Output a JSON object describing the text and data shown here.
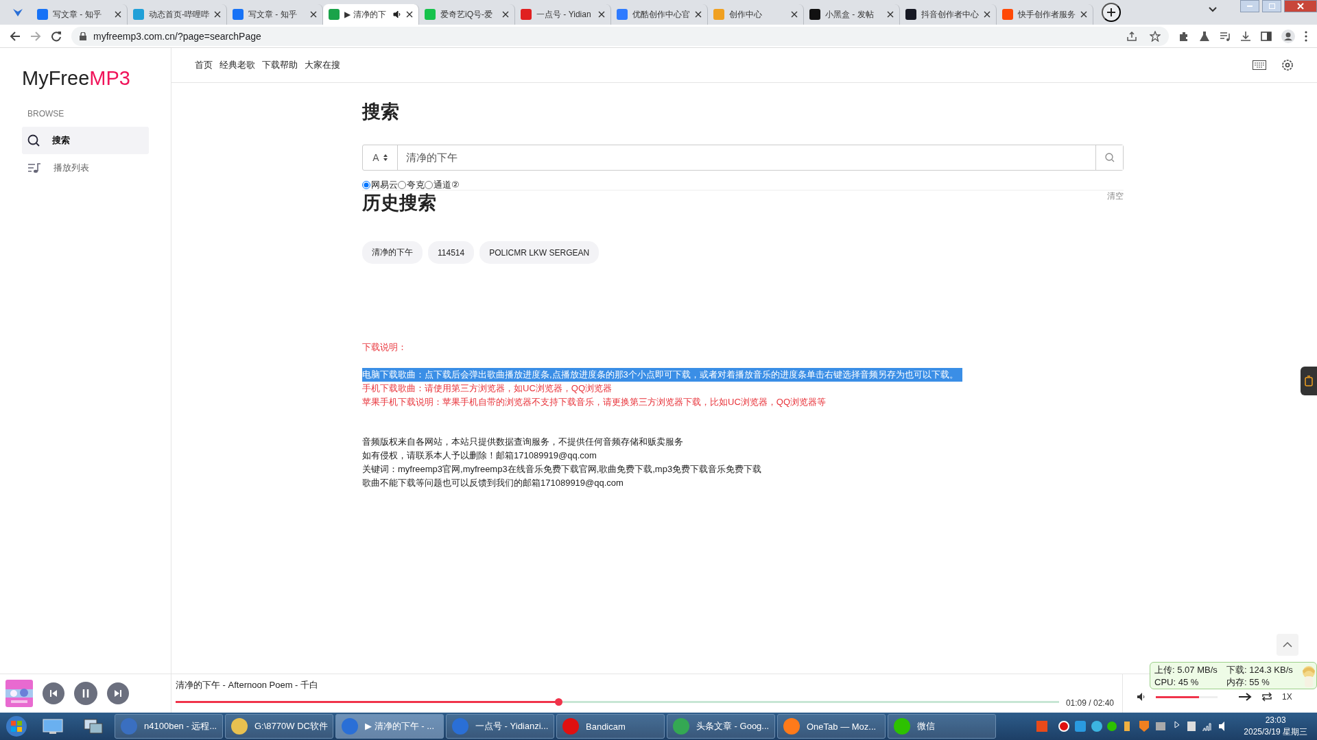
{
  "browser": {
    "tabs": [
      {
        "title": "写文章 - 知乎",
        "color": "#1772f6",
        "selected": false,
        "audio": false
      },
      {
        "title": "动态首页-哔哩哔",
        "color": "#20a0d8",
        "selected": false,
        "audio": false
      },
      {
        "title": "写文章 - 知乎",
        "color": "#1772f6",
        "selected": false,
        "audio": false
      },
      {
        "title": "▶ 清净的下",
        "color": "#1aa34a",
        "selected": true,
        "audio": true
      },
      {
        "title": "爱奇艺iQ号-爱",
        "color": "#16c24c",
        "selected": false,
        "audio": false
      },
      {
        "title": "一点号 - Yidian",
        "color": "#e02020",
        "selected": false,
        "audio": false
      },
      {
        "title": "优酷创作中心官",
        "color": "#2f7bff",
        "selected": false,
        "audio": false
      },
      {
        "title": "创作中心",
        "color": "#f0a020",
        "selected": false,
        "audio": false
      },
      {
        "title": "小黑盒 - 发帖",
        "color": "#111111",
        "selected": false,
        "audio": false
      },
      {
        "title": "抖音创作者中心",
        "color": "#161823",
        "selected": false,
        "audio": false
      },
      {
        "title": "快手创作者服务",
        "color": "#ff4906",
        "selected": false,
        "audio": false
      }
    ],
    "url": "myfreemp3.com.cn/?page=searchPage"
  },
  "logo": {
    "main": "MyFree",
    "accent": "MP3"
  },
  "sidebar": {
    "heading": "BROWSE",
    "items": [
      {
        "label": "搜索",
        "kind": "search",
        "selected": true
      },
      {
        "label": "播放列表",
        "kind": "playlist",
        "selected": false
      }
    ]
  },
  "nav": [
    "首页",
    "经典老歌",
    "下载帮助",
    "大家在搜"
  ],
  "page_title": "搜索",
  "search": {
    "mode": "A",
    "value": "清净的下午"
  },
  "sources": [
    {
      "label": "网易云",
      "selected": true
    },
    {
      "label": "夸克",
      "selected": false
    },
    {
      "label": "通道②",
      "selected": false
    }
  ],
  "history": {
    "title": "历史搜索",
    "clear": "清空",
    "chips": [
      "清净的下午",
      "114514",
      "POLICMR LKW SERGEAN"
    ]
  },
  "notice": {
    "title": "下载说明：",
    "lines": [
      {
        "text": "电脑下载歌曲：点下载后会弹出歌曲播放进度条,点播放进度条的那3个小点即可下载，或者对着播放音乐的进度条单击右键选择音频另存为也可以下载。",
        "highlighted": true
      },
      {
        "text": "手机下载歌曲：请使用第三方浏览器，如UC浏览器，QQ浏览器",
        "highlighted": false
      },
      {
        "text": "苹果手机下载说明：苹果手机自带的浏览器不支持下载音乐，请更换第三方浏览器下载，比如UC浏览器，QQ浏览器等",
        "highlighted": false
      }
    ]
  },
  "footer_lines": [
    "音频版权来自各网站，本站只提供数据查询服务，不提供任何音频存储和贩卖服务",
    "如有侵权，请联系本人予以删除！邮箱171089919@qq.com",
    "关键词：myfreemp3官网,myfreemp3在线音乐免费下载官网,歌曲免费下载,mp3免费下载音乐免费下载",
    "歌曲不能下载等问题也可以反馈到我们的邮箱171089919@qq.com"
  ],
  "player": {
    "track": "清净的下午 - Afternoon Poem - 千白",
    "time": "01:09 / 02:40",
    "level": 0.433,
    "playing": true,
    "volume": {
      "level": 0.7
    },
    "speed": "1X"
  },
  "netmon": {
    "up": "上传: 5.07 MB/s",
    "down": "下载: 124.3 KB/s",
    "cpu": "CPU: 45 %",
    "mem": "内存: 55 %"
  },
  "taskbar": {
    "items": [
      {
        "label": "n4100ben - 远程...",
        "color": "#3a6fc0",
        "selected": false
      },
      {
        "label": "G:\\8770W DC软件",
        "color": "#e8c050",
        "selected": false
      },
      {
        "label": "▶ 清净的下午 - ...",
        "color": "#2a6fd6",
        "selected": true
      },
      {
        "label": "一点号 - Yidianzi...",
        "color": "#2a6fd6",
        "selected": false
      },
      {
        "label": "Bandicam",
        "color": "#e01010",
        "selected": false
      },
      {
        "label": "头条文章 - Goog...",
        "color": "#34a853",
        "selected": false
      },
      {
        "label": "OneTab — Moz...",
        "color": "#ff7a1a",
        "selected": false
      },
      {
        "label": "微信",
        "color": "#2dc100",
        "selected": false
      }
    ],
    "time": "23:03",
    "date": "2025/3/19 星期三"
  }
}
